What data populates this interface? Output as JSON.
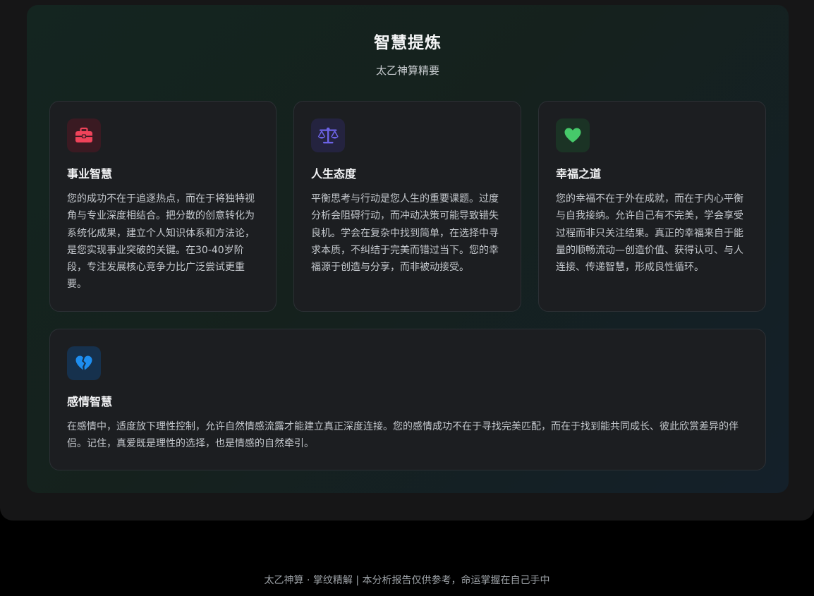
{
  "section": {
    "title": "智慧提炼",
    "subtitle": "太乙神算精要"
  },
  "cards": [
    {
      "icon": "briefcase-icon",
      "accent": "#f0435a",
      "title": "事业智慧",
      "text": "您的成功不在于追逐热点，而在于将独特视角与专业深度相结合。把分散的创意转化为系统化成果，建立个人知识体系和方法论，是您实现事业突破的关键。在30-40岁阶段，专注发展核心竞争力比广泛尝试更重要。"
    },
    {
      "icon": "balance-scale-icon",
      "accent": "#6c63e6",
      "title": "人生态度",
      "text": "平衡思考与行动是您人生的重要课题。过度分析会阻碍行动，而冲动决策可能导致错失良机。学会在复杂中找到简单，在选择中寻求本质，不纠结于完美而错过当下。您的幸福源于创造与分享，而非被动接受。"
    },
    {
      "icon": "heart-icon",
      "accent": "#46c96a",
      "title": "幸福之道",
      "text": "您的幸福不在于外在成就，而在于内心平衡与自我接纳。允许自己有不完美，学会享受过程而非只关注结果。真正的幸福来自于能量的顺畅流动—创造价值、获得认可、与人连接、传递智慧，形成良性循环。"
    },
    {
      "icon": "broken-heart-icon",
      "accent": "#1e8ef0",
      "title": "感情智慧",
      "text": "在感情中，适度放下理性控制，允许自然情感流露才能建立真正深度连接。您的感情成功不在于寻找完美匹配，而在于找到能共同成长、彼此欣赏差异的伴侣。记住，真爱既是理性的选择，也是情感的自然牵引。"
    }
  ],
  "footer": {
    "text": "太乙神算 · 掌纹精解 | 本分析报告仅供参考，命运掌握在自己手中"
  }
}
